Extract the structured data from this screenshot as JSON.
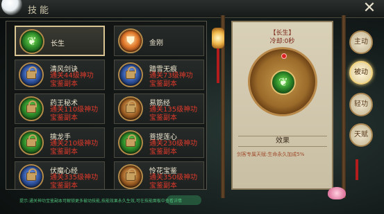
{
  "header": {
    "title": "技能",
    "close_label": "✕"
  },
  "skills": [
    {
      "name": "长生",
      "requirement_line1": "",
      "requirement_line2": "",
      "icon": "green-leaf-icon",
      "locked": false,
      "selected": true
    },
    {
      "name": "金刚",
      "requirement_line1": "",
      "requirement_line2": "",
      "icon": "orange-shield-icon",
      "locked": false,
      "selected": false
    },
    {
      "name": "清风剑诀",
      "requirement_line1": "通关44级神功",
      "requirement_line2": "宝鉴副本",
      "icon": "blue-lock-icon",
      "locked": true
    },
    {
      "name": "踏雪无痕",
      "requirement_line1": "通关73级神功",
      "requirement_line2": "宝鉴副本",
      "icon": "blue-lock-icon",
      "locked": true
    },
    {
      "name": "药王秘术",
      "requirement_line1": "通关110级神功",
      "requirement_line2": "宝鉴副本",
      "icon": "green-lock-icon",
      "locked": true
    },
    {
      "name": "易筋经",
      "requirement_line1": "通关135级神功",
      "requirement_line2": "宝鉴副本",
      "icon": "brown-lock-icon",
      "locked": true
    },
    {
      "name": "擒龙手",
      "requirement_line1": "通关210级神功",
      "requirement_line2": "宝鉴副本",
      "icon": "green-lock-icon",
      "locked": true
    },
    {
      "name": "菩提莲心",
      "requirement_line1": "通关230级神功",
      "requirement_line2": "宝鉴副本",
      "icon": "green-lock-icon",
      "locked": true
    },
    {
      "name": "伏魔心经",
      "requirement_line1": "通关335级神功",
      "requirement_line2": "宝鉴副本",
      "icon": "blue-lock-icon",
      "locked": true
    },
    {
      "name": "怜花宝鉴",
      "requirement_line1": "通关350级神功",
      "requirement_line2": "宝鉴副本",
      "icon": "brown-lock-icon",
      "locked": true
    }
  ],
  "detail": {
    "skill_title": "【长生】",
    "cooldown": "冷却:0秒",
    "effect_header": "效果",
    "effect_text": "剑客专属天赋:生命永久加成5%"
  },
  "tabs": [
    {
      "label": "主动",
      "active": false
    },
    {
      "label": "被动",
      "active": true
    },
    {
      "label": "轻功",
      "active": false
    },
    {
      "label": "天赋",
      "active": false
    }
  ],
  "hint_text": "提示:通关神功宝鉴副本可解锁更多被动技能,技能效果永久生效,可在技能面板中查看详情",
  "colors": {
    "requirement_red": "#e23a2c",
    "selected_border": "#d9c493",
    "scroll_paper": "#d9d0b8"
  }
}
